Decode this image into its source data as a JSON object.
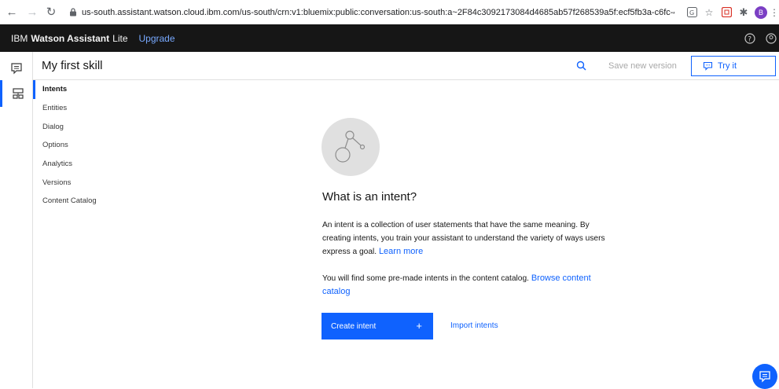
{
  "browser": {
    "url": "us-south.assistant.watson.cloud.ibm.com/us-south/crn:v1:bluemix:public:conversation:us-south:a~2F84c3092173084d4685ab57f268539a5f:ecf5fb3a-c6fc-43c8-ae6...",
    "profile_initial": "B"
  },
  "topbar": {
    "brand_ibm": "IBM",
    "brand_product": "Watson Assistant",
    "brand_plan": "Lite",
    "upgrade": "Upgrade"
  },
  "header": {
    "skill_title": "My first skill",
    "save_version": "Save new version",
    "try_it": "Try it"
  },
  "subnav": {
    "items": [
      {
        "label": "Intents"
      },
      {
        "label": "Entities"
      },
      {
        "label": "Dialog"
      },
      {
        "label": "Options"
      },
      {
        "label": "Analytics"
      },
      {
        "label": "Versions"
      },
      {
        "label": "Content Catalog"
      }
    ]
  },
  "main": {
    "title": "What is an intent?",
    "para1": "An intent is a collection of user statements that have the same meaning. By creating intents, you train your assistant to understand the variety of ways users express a goal.",
    "learn_more": "Learn more",
    "para2": "You will find some pre-made intents in the content catalog.",
    "browse_catalog": "Browse content catalog",
    "create_intent": "Create intent",
    "create_plus": "+",
    "import_intents": "Import intents"
  },
  "colors": {
    "accent": "#0f62fe",
    "topbar_bg": "#161616"
  }
}
